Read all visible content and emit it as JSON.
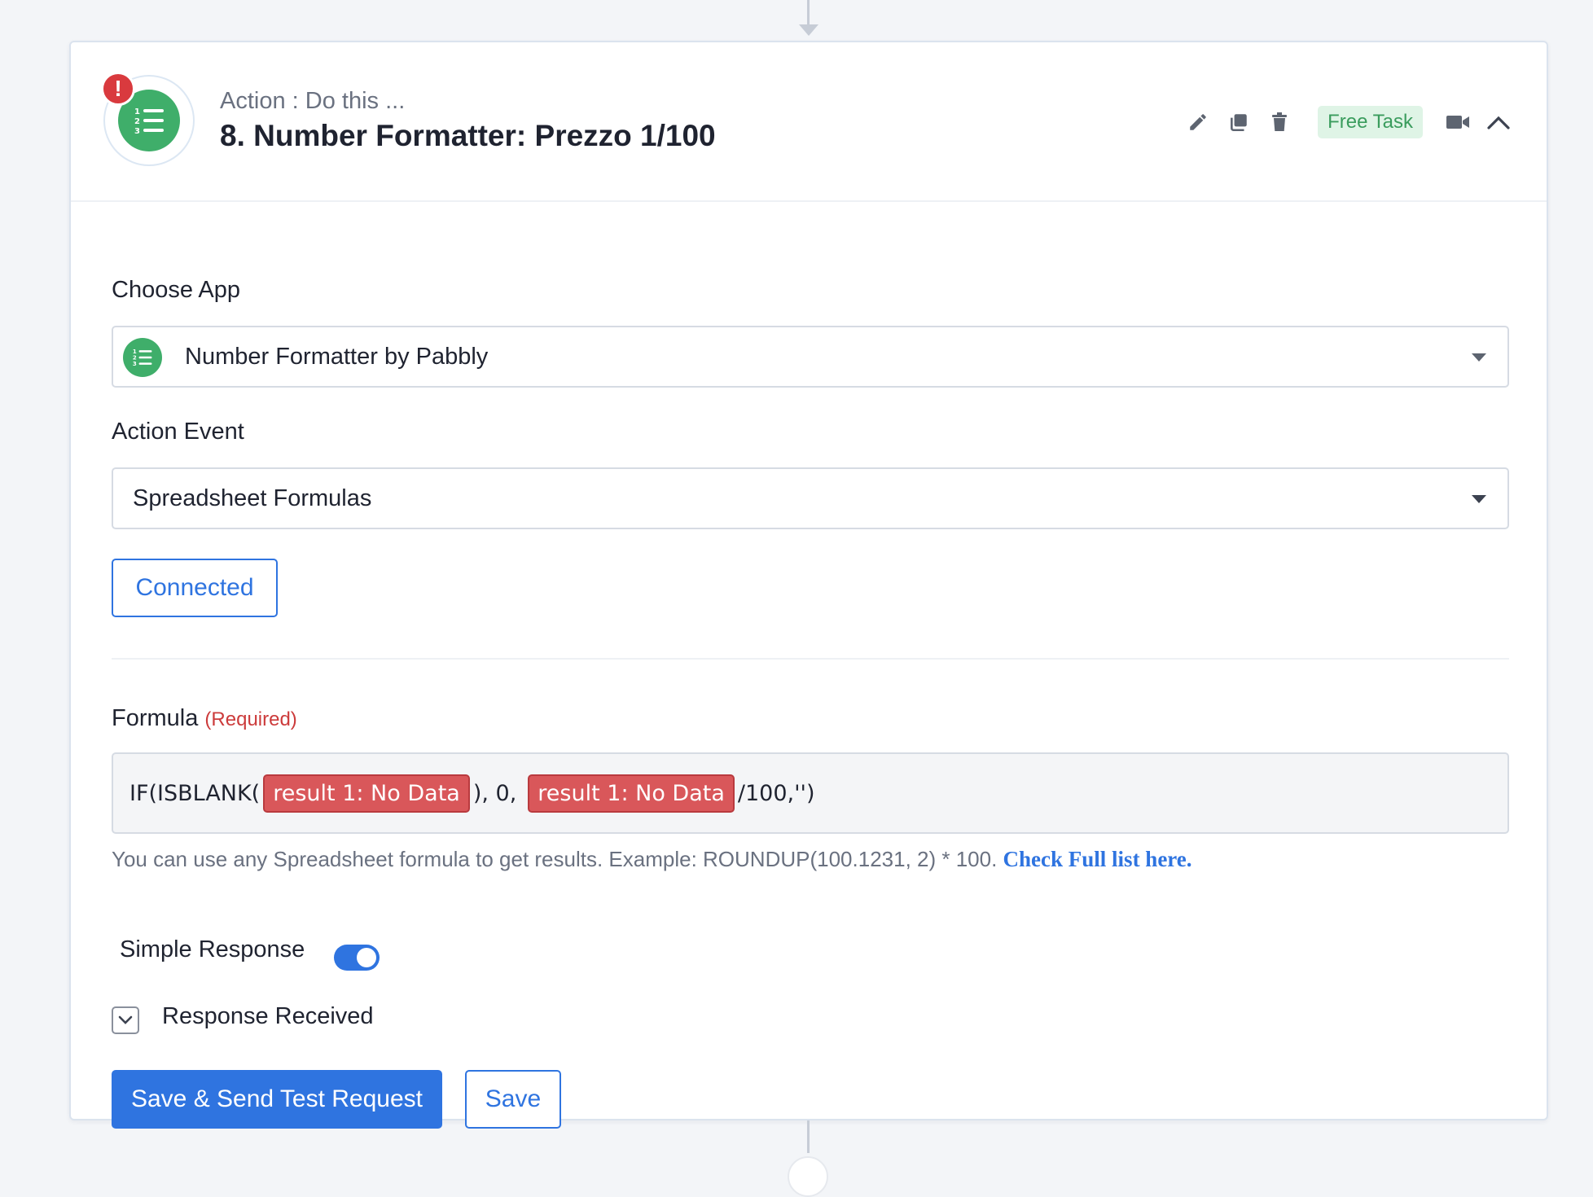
{
  "header": {
    "subtitle": "Action : Do this ...",
    "title": "8. Number Formatter: Prezzo 1/100",
    "error_badge": "!",
    "free_task_label": "Free Task",
    "icons": [
      "pencil-icon",
      "copy-icon",
      "trash-icon",
      "video-icon",
      "chevron-up-icon"
    ]
  },
  "choose_app": {
    "label": "Choose App",
    "value": "Number Formatter by Pabbly"
  },
  "action_event": {
    "label": "Action Event",
    "value": "Spreadsheet Formulas"
  },
  "connection": {
    "button_label": "Connected"
  },
  "formula": {
    "label": "Formula",
    "required_label": "(Required)",
    "part1": "IF(ISBLANK(",
    "pill1": "result 1: No Data",
    "part2": "), 0,",
    "pill2": "result 1: No Data",
    "part3": "/100,'')",
    "helper_text": "You can use any Spreadsheet formula to get results. Example: ROUNDUP(100.1231, 2) * 100.",
    "helper_link": "Check Full list here."
  },
  "simple_response": {
    "label": "Simple Response",
    "enabled": true
  },
  "response_received": {
    "label": "Response Received"
  },
  "buttons": {
    "save_send": "Save & Send Test Request",
    "save": "Save"
  },
  "colors": {
    "primary": "#2f74e0",
    "app_green": "#3fae6a",
    "error_red": "#d93a3e",
    "pill_red": "#d9575a"
  }
}
